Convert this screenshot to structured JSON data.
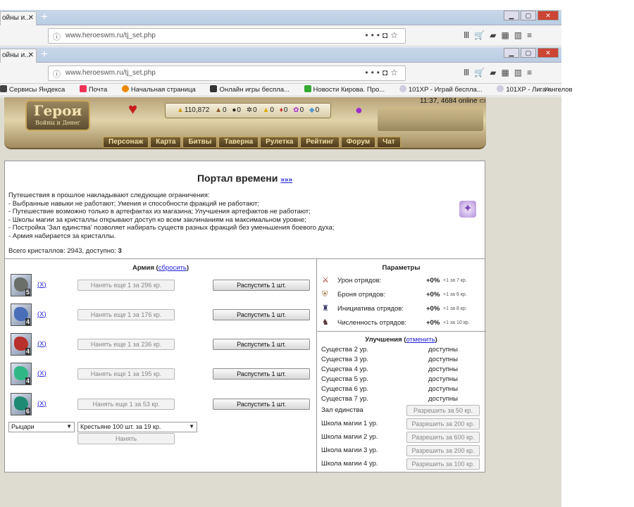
{
  "browser": {
    "tab_title": "ойны и...",
    "url": "www.heroeswm.ru/tj_set.php",
    "bookmarks": [
      "Сервисы Яндекса",
      "Почта",
      "Начальная страница",
      "Онлайн игры беспла...",
      "Новости Кирова. Про...",
      "101XP - Играй беспла...",
      "101XP - Лига ангелов"
    ]
  },
  "header": {
    "logo_title": "Герои",
    "logo_subtitle": "Войны и Денег",
    "gold": "110,872",
    "wood": "0",
    "ore": "0",
    "mercury": "0",
    "sulfur": "0",
    "crystals": "0",
    "gems": "0",
    "diamonds": "0",
    "time_online": "11:37, 4684 online",
    "nav": [
      "Персонаж",
      "Карта",
      "Битвы",
      "Таверна",
      "Рулетка",
      "Рейтинг",
      "Форум",
      "Чат"
    ]
  },
  "portal": {
    "title": "Портал времени",
    "more_link": "»»»",
    "intro": [
      "Путешествия в прошлое накладывают следующие ограничения:",
      "- Выбранные навыки не работают; Умения и способности фракций не работают;",
      "- Путешествие возможно только в артефактах из магазина; Улучшения артефактов не работают;",
      "- Школы магии за кристаллы открывают доступ ко всем заклинаниям на максимальном уровне;",
      "- Постройка 'Зал единства' позволяет набирать существ разных фракций без уменьшения боевого духа;",
      "- Армия набирается за кристаллы."
    ],
    "crystals_label": "Всего кристаллов: 2943, доступно: ",
    "crystals_available": "3"
  },
  "army": {
    "title": "Армия",
    "reset": "сбросить",
    "units": [
      {
        "level": "5",
        "x": "X",
        "hire": "Нанять еще 1 за 296 кр.",
        "dismiss": "Распустить 1 шт.",
        "color": "#6b6f6a"
      },
      {
        "level": "4",
        "x": "X",
        "hire": "Нанять еще 1 за 176 кр.",
        "dismiss": "Распустить 1 шт.",
        "color": "#4a6fb8"
      },
      {
        "level": "4",
        "x": "X",
        "hire": "Нанять еще 1 за 236 кр.",
        "dismiss": "Распустить 1 шт.",
        "color": "#b8312b"
      },
      {
        "level": "4",
        "x": "X",
        "hire": "Нанять еще 1 за 195 кр.",
        "dismiss": "Распустить 1 шт.",
        "color": "#2fb886"
      },
      {
        "level": "6",
        "x": "X",
        "hire": "Нанять еще 1 за 53 кр.",
        "dismiss": "Распустить 1 шт.",
        "color": "#1f8a73"
      }
    ],
    "faction_select": "Рыцари",
    "unit_select": "Крестьяне 100 шт. за 19 кр.",
    "hire_button": "Нанять"
  },
  "params": {
    "title": "Параметры",
    "rows": [
      {
        "name": "Урон отрядов:",
        "value": "+0%",
        "hint": "+1 за 7 кр.",
        "icon": "sword-icon"
      },
      {
        "name": "Броня отрядов:",
        "value": "+0%",
        "hint": "+1 за 6 кр.",
        "icon": "armor-icon"
      },
      {
        "name": "Инициатива отрядов:",
        "value": "+0%",
        "hint": "+1 за 8 кр.",
        "icon": "initiative-icon"
      },
      {
        "name": "Численность отрядов:",
        "value": "+0%",
        "hint": "+1 за 10 кр.",
        "icon": "troops-icon"
      }
    ]
  },
  "upgrades": {
    "title": "Улучшения",
    "cancel": "отменить",
    "creatures": [
      {
        "name": "Существа 2 ур.",
        "status": "доступны"
      },
      {
        "name": "Существа 3 ур.",
        "status": "доступны"
      },
      {
        "name": "Существа 4 ур.",
        "status": "доступны"
      },
      {
        "name": "Существа 5 ур.",
        "status": "доступны"
      },
      {
        "name": "Существа 6 ур.",
        "status": "доступны"
      },
      {
        "name": "Существа 7 ур.",
        "status": "доступны"
      }
    ],
    "buildings": [
      {
        "name": "Зал единства",
        "button": "Разрешить за 50 кр."
      },
      {
        "name": "Школа магии 1 ур.",
        "button": "Разрешить за 200 кр."
      },
      {
        "name": "Школа магии 2 ур.",
        "button": "Разрешить за 600 кр."
      },
      {
        "name": "Школа магии 3 ур.",
        "button": "Разрешить за 200 кр."
      },
      {
        "name": "Школа магии 4 ур.",
        "button": "Разрешить за 100 кр."
      }
    ]
  }
}
